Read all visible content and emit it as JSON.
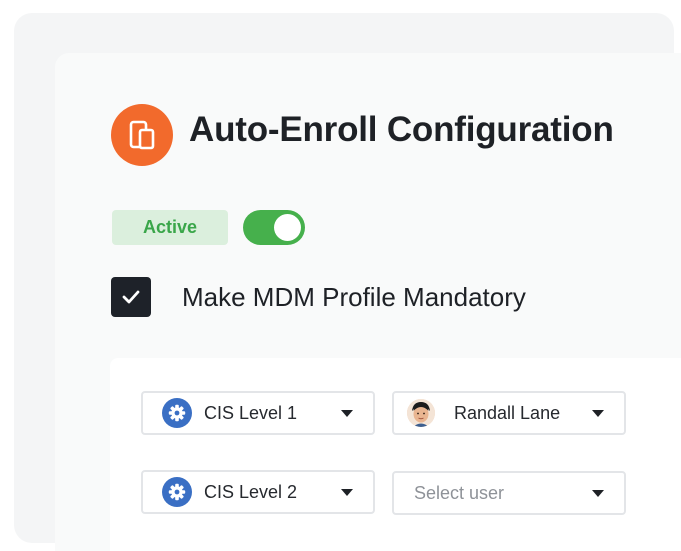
{
  "header": {
    "title": "Auto-Enroll Configuration",
    "icon": "devices-icon",
    "icon_color": "#f26a2c"
  },
  "status": {
    "badge_label": "Active",
    "badge_color": "#3aa64a",
    "toggle_on": true,
    "toggle_color": "#46b04c"
  },
  "mandatory": {
    "checked": true,
    "label": "Make MDM Profile Mandatory"
  },
  "rows": [
    {
      "profile": {
        "label": "CIS Level 1",
        "icon": "gear-icon"
      },
      "user": {
        "value": "Randall Lane",
        "placeholder": "",
        "icon": "avatar"
      }
    },
    {
      "profile": {
        "label": "CIS Level 2",
        "icon": "gear-icon"
      },
      "user": {
        "value": "",
        "placeholder": "Select user"
      }
    }
  ]
}
